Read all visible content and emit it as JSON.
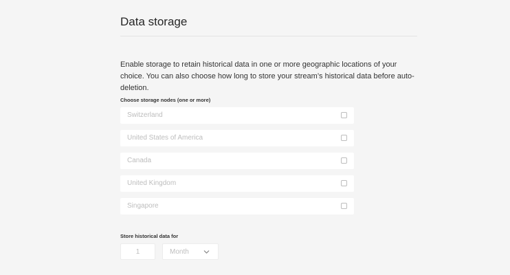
{
  "section": {
    "title": "Data storage",
    "description": "Enable storage to retain historical data in one or more geographic locations of your choice. You can also choose how long to store your stream’s historical data before auto-deletion."
  },
  "storage_nodes": {
    "label": "Choose storage nodes (one or more)",
    "items": [
      {
        "name": "Switzerland",
        "checked": false
      },
      {
        "name": "United States of America",
        "checked": false
      },
      {
        "name": "Canada",
        "checked": false
      },
      {
        "name": "United Kingdom",
        "checked": false
      },
      {
        "name": "Singapore",
        "checked": false
      }
    ]
  },
  "retention": {
    "label": "Store historical data for",
    "amount": "1",
    "unit": "Month"
  },
  "colors": {
    "background": "#f5f5f5",
    "field": "#ffffff",
    "placeholder_text": "#bdbdbd",
    "body_text": "#323232"
  }
}
